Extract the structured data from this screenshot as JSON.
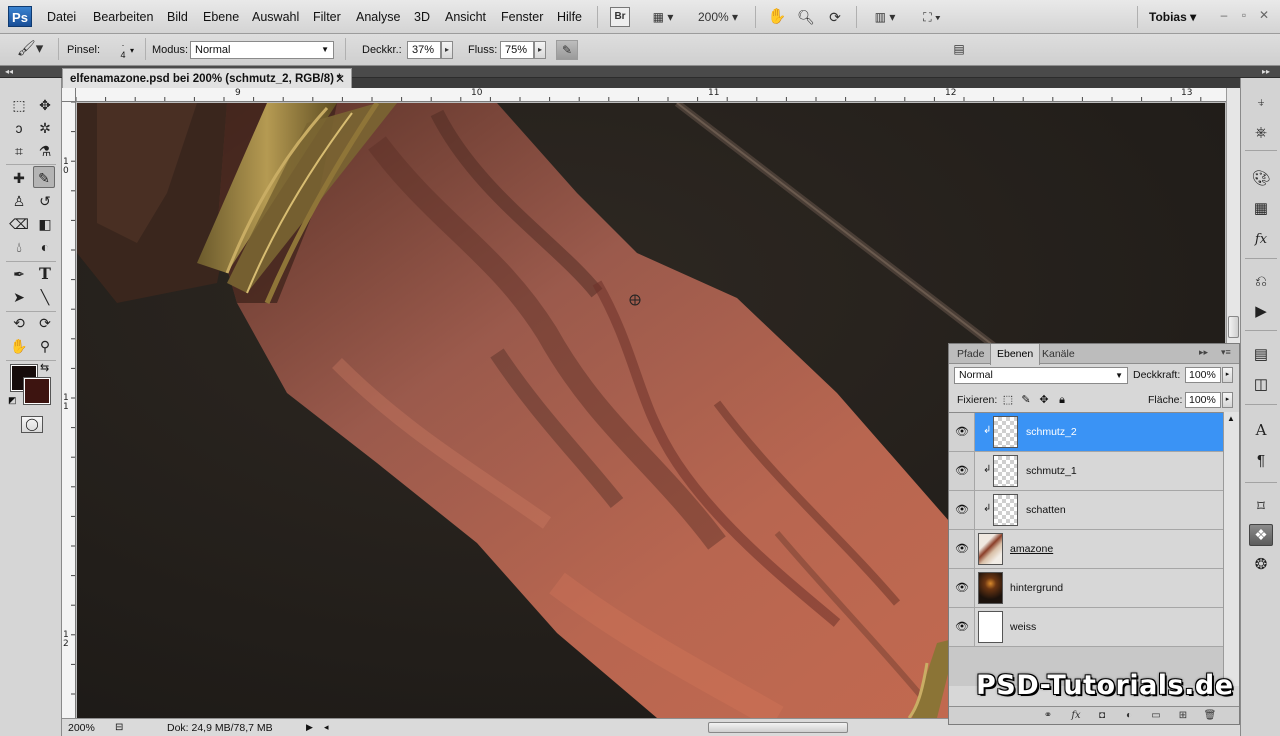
{
  "app": {
    "logo": "Ps",
    "user": "Tobias"
  },
  "menu": [
    "Datei",
    "Bearbeiten",
    "Bild",
    "Ebene",
    "Auswahl",
    "Filter",
    "Analyse",
    "3D",
    "Ansicht",
    "Fenster",
    "Hilfe"
  ],
  "menubar": {
    "zoom": "200%",
    "bridge_label": "Br"
  },
  "options": {
    "brush_label": "Pinsel:",
    "brush_size": "4",
    "mode_label": "Modus:",
    "mode_value": "Normal",
    "opacity_label": "Deckkr.:",
    "opacity_value": "37%",
    "flow_label": "Fluss:",
    "flow_value": "75%"
  },
  "document": {
    "tab_title": "elfenamazone.psd bei 200% (schmutz_2, RGB/8) *",
    "ruler_top": [
      "9",
      "10",
      "11",
      "12",
      "13"
    ],
    "ruler_left": [
      "1\n0",
      "1\n1",
      "1\n2"
    ]
  },
  "statusbar": {
    "zoom": "200%",
    "doc_info": "Dok: 24,9 MB/78,7 MB"
  },
  "toolbox": {
    "tools": [
      "marquee-tool",
      "move-tool",
      "lasso-tool",
      "magic-wand-tool",
      "crop-tool",
      "eyedropper-tool",
      "healing-brush-tool",
      "brush-tool",
      "clone-stamp-tool",
      "history-brush-tool",
      "eraser-tool",
      "gradient-tool",
      "blur-tool",
      "dodge-tool",
      "pen-tool",
      "type-tool",
      "path-selection-tool",
      "line-tool",
      "3d-rotate-tool",
      "3d-orbit-tool",
      "hand-tool",
      "zoom-tool"
    ],
    "foreground_color": "#160c0b",
    "background_color": "#3d1410"
  },
  "layers_panel": {
    "tabs": [
      "Pfade",
      "Ebenen",
      "Kanäle"
    ],
    "active_tab": "Ebenen",
    "blend_mode": "Normal",
    "opacity_label": "Deckkraft:",
    "opacity_value": "100%",
    "lock_label": "Fixieren:",
    "fill_label": "Fläche:",
    "fill_value": "100%",
    "layers": [
      {
        "name": "schmutz_2",
        "selected": true,
        "clipped": true,
        "thumb": "transparent"
      },
      {
        "name": "schmutz_1",
        "selected": false,
        "clipped": true,
        "thumb": "transparent"
      },
      {
        "name": "schatten",
        "selected": false,
        "clipped": true,
        "thumb": "transparent"
      },
      {
        "name": "amazone",
        "selected": false,
        "clipped": false,
        "thumb": "figure"
      },
      {
        "name": "hintergrund",
        "selected": false,
        "clipped": false,
        "thumb": "dark-scene"
      },
      {
        "name": "weiss",
        "selected": false,
        "clipped": false,
        "thumb": "white"
      }
    ]
  },
  "watermark": "PSD-Tutorials.de",
  "colors": {
    "selection_blue": "#3a93f5",
    "canvas_background": "#2b2420"
  }
}
